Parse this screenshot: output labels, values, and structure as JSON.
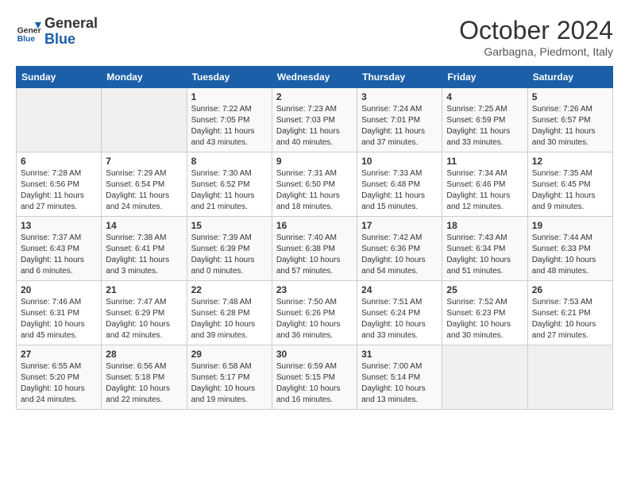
{
  "header": {
    "logo_line1": "General",
    "logo_line2": "Blue",
    "month": "October 2024",
    "location": "Garbagna, Piedmont, Italy"
  },
  "days_of_week": [
    "Sunday",
    "Monday",
    "Tuesday",
    "Wednesday",
    "Thursday",
    "Friday",
    "Saturday"
  ],
  "weeks": [
    [
      {
        "num": "",
        "empty": true
      },
      {
        "num": "",
        "empty": true
      },
      {
        "num": "1",
        "sunrise": "7:22 AM",
        "sunset": "7:05 PM",
        "daylight": "11 hours and 43 minutes."
      },
      {
        "num": "2",
        "sunrise": "7:23 AM",
        "sunset": "7:03 PM",
        "daylight": "11 hours and 40 minutes."
      },
      {
        "num": "3",
        "sunrise": "7:24 AM",
        "sunset": "7:01 PM",
        "daylight": "11 hours and 37 minutes."
      },
      {
        "num": "4",
        "sunrise": "7:25 AM",
        "sunset": "6:59 PM",
        "daylight": "11 hours and 33 minutes."
      },
      {
        "num": "5",
        "sunrise": "7:26 AM",
        "sunset": "6:57 PM",
        "daylight": "11 hours and 30 minutes."
      }
    ],
    [
      {
        "num": "6",
        "sunrise": "7:28 AM",
        "sunset": "6:56 PM",
        "daylight": "11 hours and 27 minutes."
      },
      {
        "num": "7",
        "sunrise": "7:29 AM",
        "sunset": "6:54 PM",
        "daylight": "11 hours and 24 minutes."
      },
      {
        "num": "8",
        "sunrise": "7:30 AM",
        "sunset": "6:52 PM",
        "daylight": "11 hours and 21 minutes."
      },
      {
        "num": "9",
        "sunrise": "7:31 AM",
        "sunset": "6:50 PM",
        "daylight": "11 hours and 18 minutes."
      },
      {
        "num": "10",
        "sunrise": "7:33 AM",
        "sunset": "6:48 PM",
        "daylight": "11 hours and 15 minutes."
      },
      {
        "num": "11",
        "sunrise": "7:34 AM",
        "sunset": "6:46 PM",
        "daylight": "11 hours and 12 minutes."
      },
      {
        "num": "12",
        "sunrise": "7:35 AM",
        "sunset": "6:45 PM",
        "daylight": "11 hours and 9 minutes."
      }
    ],
    [
      {
        "num": "13",
        "sunrise": "7:37 AM",
        "sunset": "6:43 PM",
        "daylight": "11 hours and 6 minutes."
      },
      {
        "num": "14",
        "sunrise": "7:38 AM",
        "sunset": "6:41 PM",
        "daylight": "11 hours and 3 minutes."
      },
      {
        "num": "15",
        "sunrise": "7:39 AM",
        "sunset": "6:39 PM",
        "daylight": "11 hours and 0 minutes."
      },
      {
        "num": "16",
        "sunrise": "7:40 AM",
        "sunset": "6:38 PM",
        "daylight": "10 hours and 57 minutes."
      },
      {
        "num": "17",
        "sunrise": "7:42 AM",
        "sunset": "6:36 PM",
        "daylight": "10 hours and 54 minutes."
      },
      {
        "num": "18",
        "sunrise": "7:43 AM",
        "sunset": "6:34 PM",
        "daylight": "10 hours and 51 minutes."
      },
      {
        "num": "19",
        "sunrise": "7:44 AM",
        "sunset": "6:33 PM",
        "daylight": "10 hours and 48 minutes."
      }
    ],
    [
      {
        "num": "20",
        "sunrise": "7:46 AM",
        "sunset": "6:31 PM",
        "daylight": "10 hours and 45 minutes."
      },
      {
        "num": "21",
        "sunrise": "7:47 AM",
        "sunset": "6:29 PM",
        "daylight": "10 hours and 42 minutes."
      },
      {
        "num": "22",
        "sunrise": "7:48 AM",
        "sunset": "6:28 PM",
        "daylight": "10 hours and 39 minutes."
      },
      {
        "num": "23",
        "sunrise": "7:50 AM",
        "sunset": "6:26 PM",
        "daylight": "10 hours and 36 minutes."
      },
      {
        "num": "24",
        "sunrise": "7:51 AM",
        "sunset": "6:24 PM",
        "daylight": "10 hours and 33 minutes."
      },
      {
        "num": "25",
        "sunrise": "7:52 AM",
        "sunset": "6:23 PM",
        "daylight": "10 hours and 30 minutes."
      },
      {
        "num": "26",
        "sunrise": "7:53 AM",
        "sunset": "6:21 PM",
        "daylight": "10 hours and 27 minutes."
      }
    ],
    [
      {
        "num": "27",
        "sunrise": "6:55 AM",
        "sunset": "5:20 PM",
        "daylight": "10 hours and 24 minutes."
      },
      {
        "num": "28",
        "sunrise": "6:56 AM",
        "sunset": "5:18 PM",
        "daylight": "10 hours and 22 minutes."
      },
      {
        "num": "29",
        "sunrise": "6:58 AM",
        "sunset": "5:17 PM",
        "daylight": "10 hours and 19 minutes."
      },
      {
        "num": "30",
        "sunrise": "6:59 AM",
        "sunset": "5:15 PM",
        "daylight": "10 hours and 16 minutes."
      },
      {
        "num": "31",
        "sunrise": "7:00 AM",
        "sunset": "5:14 PM",
        "daylight": "10 hours and 13 minutes."
      },
      {
        "num": "",
        "empty": true
      },
      {
        "num": "",
        "empty": true
      }
    ]
  ]
}
